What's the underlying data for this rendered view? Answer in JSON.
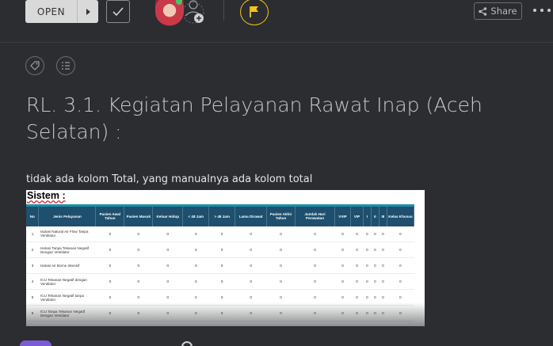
{
  "toolbar": {
    "open_label": "OPEN",
    "share_label": "Share"
  },
  "page": {
    "title": "RL. 3.1. Kegiatan Pelayanan Rawat Inap (Aceh Selatan) :",
    "note": "tidak ada kolom Total, yang manualnya ada kolom total"
  },
  "embed": {
    "heading": "Sistem :",
    "columns": [
      "No",
      "Jenis Pelayanan",
      "Pasien Awal Tahun",
      "Pasien Masuk",
      "Keluar Hidup",
      "< 48 Jam",
      "> 48 Jam",
      "Lama Dirawat",
      "Pasien Akhir Tahun",
      "Jumlah Hari Perawatan",
      "VVIP",
      "VIP",
      "I",
      "II",
      "III",
      "Kelas Khusus"
    ],
    "rows": [
      {
        "no": "1",
        "name": "Isolasi Natural Air Flow Tanpa Ventilator",
        "values": [
          "0",
          "0",
          "0",
          "0",
          "0",
          "0",
          "0",
          "0",
          "0",
          "0",
          "0",
          "0",
          "0",
          "0"
        ]
      },
      {
        "no": "2",
        "name": "Isolasi Tanpa Tekanan Negatif Dengan Ventilator",
        "values": [
          "0",
          "0",
          "0",
          "0",
          "0",
          "0",
          "0",
          "0",
          "0",
          "0",
          "0",
          "0",
          "0",
          "0"
        ]
      },
      {
        "no": "3",
        "name": "Isolasi Air Borne Intensif",
        "values": [
          "0",
          "0",
          "0",
          "0",
          "0",
          "0",
          "0",
          "0",
          "0",
          "0",
          "0",
          "0",
          "0",
          "0"
        ]
      },
      {
        "no": "4",
        "name": "ICU Tekanan Negatif dengan Ventilator",
        "values": [
          "0",
          "0",
          "0",
          "0",
          "0",
          "0",
          "0",
          "0",
          "0",
          "0",
          "0",
          "0",
          "0",
          "0"
        ]
      },
      {
        "no": "5",
        "name": "ICU Tekanan Negatif tanpa Ventilator",
        "values": [
          "0",
          "0",
          "0",
          "0",
          "0",
          "0",
          "0",
          "0",
          "0",
          "0",
          "0",
          "0",
          "0",
          "0"
        ]
      },
      {
        "no": "6",
        "name": "ICU Tanpa Tekanan Negatif Dengan Ventilator",
        "values": [
          "0",
          "0",
          "0",
          "0",
          "0",
          "0",
          "0",
          "0",
          "0",
          "0",
          "0",
          "0",
          "0",
          "0"
        ]
      }
    ]
  },
  "colors": {
    "background": "#2b2d30",
    "flag_accent": "#f5c518",
    "table_header": "#1e4f6e",
    "table_header_top": "#1e8fa8",
    "bottom_pill": "#7b5cd6"
  },
  "icons": {
    "open_caret": "caret-right-icon",
    "complete": "check-icon",
    "add_member": "add-person-icon",
    "flag": "flag-icon",
    "share": "share-icon",
    "more": "more-dots-icon",
    "tag": "tag-icon",
    "checklist": "checklist-icon",
    "search": "search-icon"
  }
}
